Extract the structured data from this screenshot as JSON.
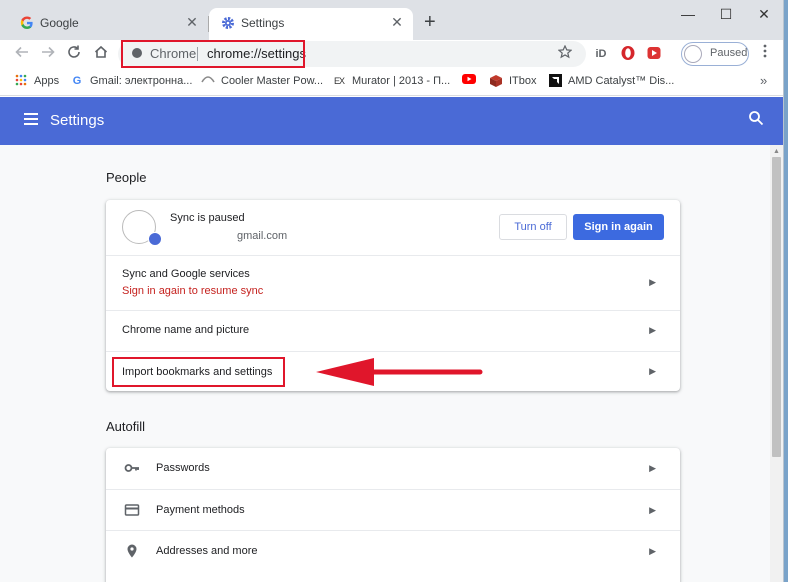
{
  "tabs": [
    {
      "title": "Google"
    },
    {
      "title": "Settings"
    }
  ],
  "tab_close_glyph": "✕",
  "new_tab_glyph": "+",
  "window_controls": {
    "minimize": "—",
    "maximize": "☐",
    "close": "✕"
  },
  "omnibox": {
    "site_label": "Chrome",
    "url": "chrome://settings"
  },
  "profile": {
    "label": "Paused"
  },
  "bookmarks": [
    {
      "label": "Apps",
      "icon": "apps-grid-icon"
    },
    {
      "label": "Gmail: электронна...",
      "icon": "google-g-icon"
    },
    {
      "label": "Cooler Master Pow...",
      "icon": "cooler-master-icon"
    },
    {
      "label": "Murator | 2013 - П...",
      "icon": "murator-icon"
    },
    {
      "label": "",
      "icon": "youtube-icon"
    },
    {
      "label": "ITbox",
      "icon": "itbox-icon"
    },
    {
      "label": "AMD Catalyst™ Dis...",
      "icon": "amd-icon"
    }
  ],
  "bookmarks_more": "»",
  "header": {
    "title": "Settings"
  },
  "people": {
    "section_title": "People",
    "sync_status": "Sync is paused",
    "email": "gmail.com",
    "turn_off_label": "Turn off",
    "sign_in_label": "Sign in again",
    "rows": [
      {
        "label": "Sync and Google services",
        "sublabel": "Sign in again to resume sync"
      },
      {
        "label": "Chrome name and picture"
      },
      {
        "label": "Import bookmarks and settings"
      }
    ]
  },
  "autofill": {
    "section_title": "Autofill",
    "rows": [
      {
        "label": "Passwords",
        "icon": "key-icon"
      },
      {
        "label": "Payment methods",
        "icon": "credit-card-icon"
      },
      {
        "label": "Addresses and more",
        "icon": "location-pin-icon"
      }
    ]
  },
  "colors": {
    "accent": "#4a6ad6",
    "highlight_red": "#e0162b",
    "warning_text": "#c5221f"
  }
}
